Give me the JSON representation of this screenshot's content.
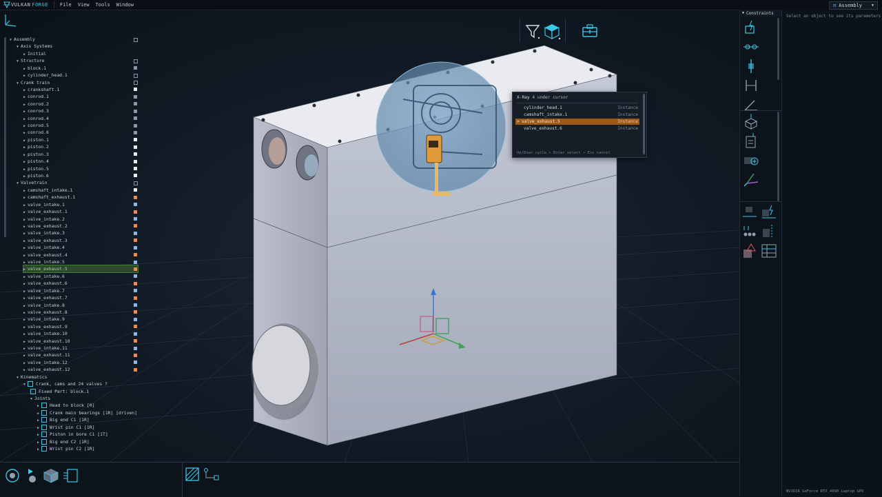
{
  "app": {
    "brand_main": "VULKAN",
    "brand_accent": "FORGE"
  },
  "menu": {
    "items": [
      "File",
      "View",
      "Tools",
      "Window"
    ],
    "workspace": "Assembly"
  },
  "right_toolbar": {
    "header": "Constraints"
  },
  "params": {
    "hint": "Select an object to see its parameters",
    "gpu": "NVIDIA GeForce RTX 4090 Laptop GPU"
  },
  "xray": {
    "title": "X-Ray",
    "subtitle": "4 under cursor",
    "rows": [
      {
        "name": "cylinder_head.1",
        "kind": "Instance"
      },
      {
        "name": "camshaft_intake.1",
        "kind": "Instance"
      },
      {
        "name": "valve_exhaust.5",
        "kind": "Instance"
      },
      {
        "name": "valve_exhaust.6",
        "kind": "Instance"
      }
    ],
    "footer": "Up/Down cycle  •  Enter select  •  Esc cancel"
  },
  "tree": [
    {
      "label": "Assembly",
      "arrow": "▼",
      "box": "empty"
    },
    {
      "label": "Axis Systems",
      "arrow": "▼",
      "box": ""
    },
    {
      "label": "Initial",
      "arrow": "▶",
      "box": ""
    },
    {
      "label": "Structure",
      "arrow": "▼",
      "box": "empty"
    },
    {
      "label": "block.1",
      "arrow": "▶",
      "box": "gray"
    },
    {
      "label": "cylinder_head.1",
      "arrow": "▶",
      "box": "empty"
    },
    {
      "label": "Crank train",
      "arrow": "▼",
      "box": "empty"
    },
    {
      "label": "crankshaft.1",
      "arrow": "▶",
      "box": "white"
    },
    {
      "label": "conrod.1",
      "arrow": "▶",
      "box": "gray"
    },
    {
      "label": "conrod.2",
      "arrow": "▶",
      "box": "gray"
    },
    {
      "label": "conrod.3",
      "arrow": "▶",
      "box": "gray"
    },
    {
      "label": "conrod.4",
      "arrow": "▶",
      "box": "gray"
    },
    {
      "label": "conrod.5",
      "arrow": "▶",
      "box": "gray"
    },
    {
      "label": "conrod.6",
      "arrow": "▶",
      "box": "gray"
    },
    {
      "label": "piston.1",
      "arrow": "▶",
      "box": "white"
    },
    {
      "label": "piston.2",
      "arrow": "▶",
      "box": "white"
    },
    {
      "label": "piston.3",
      "arrow": "▶",
      "box": "white"
    },
    {
      "label": "piston.4",
      "arrow": "▶",
      "box": "white"
    },
    {
      "label": "piston.5",
      "arrow": "▶",
      "box": "white"
    },
    {
      "label": "piston.6",
      "arrow": "▶",
      "box": "white"
    },
    {
      "label": "Valvetrain",
      "arrow": "▼",
      "box": "empty"
    },
    {
      "label": "camshaft_intake.1",
      "arrow": "▶",
      "box": "white"
    },
    {
      "label": "camshaft_exhaust.1",
      "arrow": "▶",
      "box": "orange"
    },
    {
      "label": "valve_intake.1",
      "arrow": "▶",
      "box": "blue"
    },
    {
      "label": "valve_exhaust.1",
      "arrow": "▶",
      "box": "orange"
    },
    {
      "label": "valve_intake.2",
      "arrow": "▶",
      "box": "blue"
    },
    {
      "label": "valve_exhaust.2",
      "arrow": "▶",
      "box": "orange"
    },
    {
      "label": "valve_intake.3",
      "arrow": "▶",
      "box": "blue"
    },
    {
      "label": "valve_exhaust.3",
      "arrow": "▶",
      "box": "orange"
    },
    {
      "label": "valve_intake.4",
      "arrow": "▶",
      "box": "blue"
    },
    {
      "label": "valve_exhaust.4",
      "arrow": "▶",
      "box": "orange"
    },
    {
      "label": "valve_intake.5",
      "arrow": "▶",
      "box": "blue"
    },
    {
      "label": "valve_exhaust.5",
      "arrow": "▶",
      "box": "orange",
      "selected": true
    },
    {
      "label": "valve_intake.6",
      "arrow": "▶",
      "box": "blue"
    },
    {
      "label": "valve_exhaust.6",
      "arrow": "▶",
      "box": "orange"
    },
    {
      "label": "valve_intake.7",
      "arrow": "▶",
      "box": "blue"
    },
    {
      "label": "valve_exhaust.7",
      "arrow": "▶",
      "box": "orange"
    },
    {
      "label": "valve_intake.8",
      "arrow": "▶",
      "box": "blue"
    },
    {
      "label": "valve_exhaust.8",
      "arrow": "▶",
      "box": "orange"
    },
    {
      "label": "valve_intake.9",
      "arrow": "▶",
      "box": "blue"
    },
    {
      "label": "valve_exhaust.9",
      "arrow": "▶",
      "box": "orange"
    },
    {
      "label": "valve_intake.10",
      "arrow": "▶",
      "box": "blue"
    },
    {
      "label": "valve_exhaust.10",
      "arrow": "▶",
      "box": "orange"
    },
    {
      "label": "valve_intake.11",
      "arrow": "▶",
      "box": "blue"
    },
    {
      "label": "valve_exhaust.11",
      "arrow": "▶",
      "box": "orange"
    },
    {
      "label": "valve_intake.12",
      "arrow": "▶",
      "box": "blue"
    },
    {
      "label": "valve_exhaust.12",
      "arrow": "▶",
      "box": "orange"
    },
    {
      "label": "Kinematics",
      "arrow": "▼",
      "box": ""
    },
    {
      "label": "Crank, cams and 24 valves  ?",
      "arrow": "▼",
      "box": "",
      "icon": "mechanism-icon"
    },
    {
      "label": "Fixed Part:  block.1",
      "arrow": "",
      "box": "",
      "icon": "fixed-icon"
    },
    {
      "label": "Joints",
      "arrow": "▼",
      "box": ""
    },
    {
      "label": "Head to block  [0]",
      "arrow": "▶",
      "box": "",
      "icon": "joint-icon"
    },
    {
      "label": "Crank main bearings  [1R]  [driven]",
      "arrow": "▶",
      "box": "",
      "icon": "joint-icon"
    },
    {
      "label": "Big end C1  [1R]",
      "arrow": "▶",
      "box": "",
      "icon": "joint-icon"
    },
    {
      "label": "Wrist pin C1  [1R]",
      "arrow": "▶",
      "box": "",
      "icon": "joint-icon"
    },
    {
      "label": "Piston in bore C1  [1T]",
      "arrow": "▶",
      "box": "",
      "icon": "joint-icon"
    },
    {
      "label": "Big end C2  [1R]",
      "arrow": "▶",
      "box": "",
      "icon": "joint-icon"
    },
    {
      "label": "Wrist pin C2  [1R]",
      "arrow": "▶",
      "box": "",
      "icon": "joint-icon"
    }
  ],
  "tree_indent": [
    0,
    1,
    2,
    1,
    2,
    2,
    1,
    2,
    2,
    2,
    2,
    2,
    2,
    2,
    2,
    2,
    2,
    2,
    2,
    2,
    1,
    2,
    2,
    2,
    2,
    2,
    2,
    2,
    2,
    2,
    2,
    2,
    2,
    2,
    2,
    2,
    2,
    2,
    2,
    2,
    2,
    2,
    2,
    2,
    2,
    2,
    2,
    1,
    2,
    3,
    3,
    4,
    4,
    4,
    4,
    4,
    4,
    4
  ],
  "colors": {
    "accent": "#3ec7e6",
    "selection": "#9c5a16",
    "tree_select": "#2c4a2b"
  }
}
